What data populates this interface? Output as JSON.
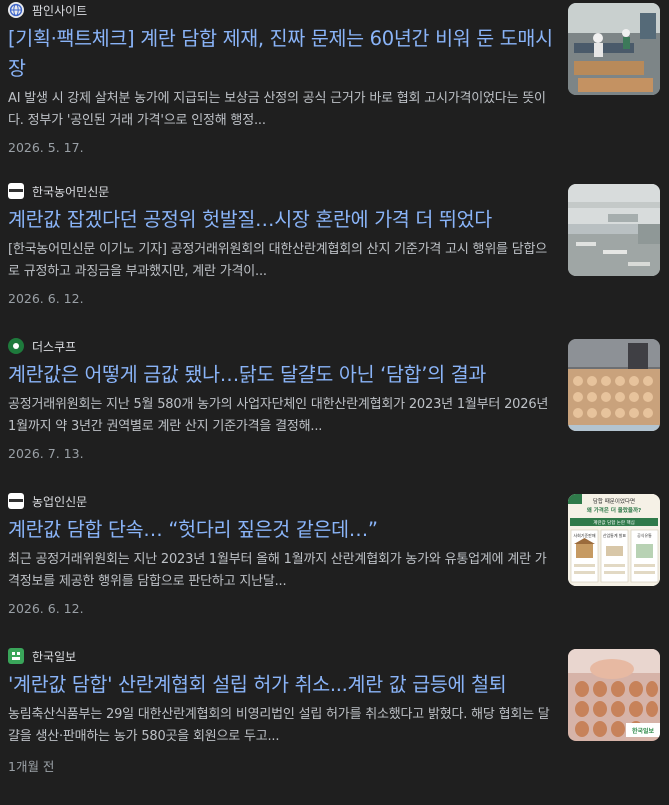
{
  "articles": [
    {
      "source": "팜인사이트",
      "title": "[기획·팩트체크] 계란 담합 제재, 진짜 문제는 60년간 비워 둔 도매시장",
      "snippet": "AI 발생 시 강제 살처분 농가에 지급되는 보상금 산정의 공식 근거가 바로 협회 고시가격이었다는 뜻이다. 정부가 '공인된 거래 가격'으로 인정해 행정...",
      "date": "2026. 5. 17.",
      "favicon_icon": "globe-icon"
    },
    {
      "source": "한국농어민신문",
      "title": "계란값 잡겠다던 공정위 헛발질…시장 혼란에 가격 더 뛰었다",
      "snippet": "[한국농어민신문 이기노 기자] 공정거래위원회의 대한산란계협회의 산지 기준가격 고시 행위를 담합으로 규정하고 과징금을 부과했지만, 계란 가격이...",
      "date": "2026. 6. 12.",
      "favicon_icon": "newspaper-icon"
    },
    {
      "source": "더스쿠프",
      "title": "계란값은 어떻게 금값 됐나…닭도 달걀도 아닌 ‘담합’의 결과",
      "snippet": "공정거래위원회는 지난 5월 580개 농가의 사업자단체인 대한산란계협회가 2023년 1월부터 2026년 1월까지 약 3년간 권역별로 계란 산지 기준가격을 결정해...",
      "date": "2026. 7. 13.",
      "favicon_icon": "scoop-icon"
    },
    {
      "source": "농업인신문",
      "title": "계란값 담합 단속… “헛다리 짚은것 같은데…”",
      "snippet": "최근 공정거래위원회는 지난 2023년 1월부터 올해 1월까지 산란계협회가 농가와 유통업계에 계란 가격정보를 제공한 행위를 담합으로 판단하고 지난달...",
      "date": "2026. 6. 12.",
      "favicon_icon": "newspaper-icon"
    },
    {
      "source": "한국일보",
      "title": "'계란값 담합' 산란계협회 설립 허가 취소...계란 값 급등에 철퇴",
      "snippet": "농림축산식품부는 29일 대한산란계협회의 비영리법인 설립 허가를 취소했다고 밝혔다. 해당 협회는 달걀을 생산·판매하는 농가 580곳을 회원으로 두고...",
      "date": "1개월 전",
      "favicon_icon": "hankook-icon"
    }
  ],
  "thumb4_text": {
    "line1": "담합 때문이었다면",
    "line2": "왜 가격은 더 올랐을까?",
    "band": "계란값 담합 논란 핵심",
    "col1": "사회기준판매",
    "col2": "산업통계 발표",
    "col3": "공식유통"
  },
  "thumb5_text": {
    "badge": "한국일보"
  },
  "colors": {
    "background": "#1f1f1f",
    "title": "#8ab4f8",
    "snippet": "#bdc1c6",
    "meta": "#9aa0a6"
  }
}
